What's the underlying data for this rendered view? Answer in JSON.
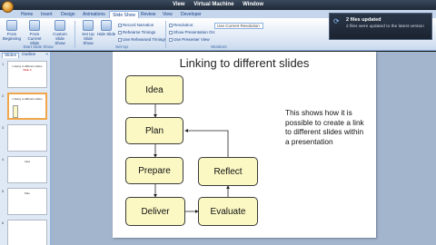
{
  "titlebar": {
    "left": "View",
    "center": "Virtual Machine",
    "right": "Window"
  },
  "tabs": [
    "Home",
    "Insert",
    "Design",
    "Animations",
    "Slide Show",
    "Review",
    "View",
    "Developer"
  ],
  "ribbon": {
    "buttons": [
      {
        "label": "From Beginning"
      },
      {
        "label": "From Current Slide"
      },
      {
        "label": "Custom Slide Show"
      },
      {
        "label": "Set Up Slide Show"
      },
      {
        "label": "Hide Slide"
      }
    ],
    "options": [
      "Record Narration",
      "Rehearse Timings",
      "Use Rehearsed Timings",
      "Resolution:",
      "Show Presentation On:",
      "Use Presenter View"
    ],
    "resolution_value": "Use Current Resolution",
    "groups": [
      "Start Slide Show",
      "Set Up",
      "Monitors"
    ]
  },
  "notification": {
    "title": "2 files updated",
    "message": "2 files were updated to the latest version"
  },
  "panel": {
    "tabs": [
      "Slides",
      "Outline"
    ],
    "close": "×",
    "thumbnails": [
      {
        "num": "1",
        "title": "Linking to different slides",
        "subtitle": "Slide 3"
      },
      {
        "num": "2",
        "title": "Linking to different slides",
        "subtitle": ""
      },
      {
        "num": "3",
        "title": "",
        "subtitle": ""
      },
      {
        "num": "4",
        "title": "Idea",
        "subtitle": ""
      },
      {
        "num": "5",
        "title": "Plan",
        "subtitle": ""
      },
      {
        "num": "6",
        "title": "",
        "subtitle": ""
      }
    ]
  },
  "slide": {
    "title": "Linking to different slides",
    "boxes": {
      "idea": "Idea",
      "plan": "Plan",
      "prepare": "Prepare",
      "reflect": "Reflect",
      "deliver": "Deliver",
      "evaluate": "Evaluate"
    },
    "text": "This shows how it is possible to create a link to different slides within a presentation"
  },
  "colors": {
    "box_fill": "#fbf8c4",
    "selected_thumb": "#f0a64a",
    "workspace": "#a3b5cc"
  }
}
